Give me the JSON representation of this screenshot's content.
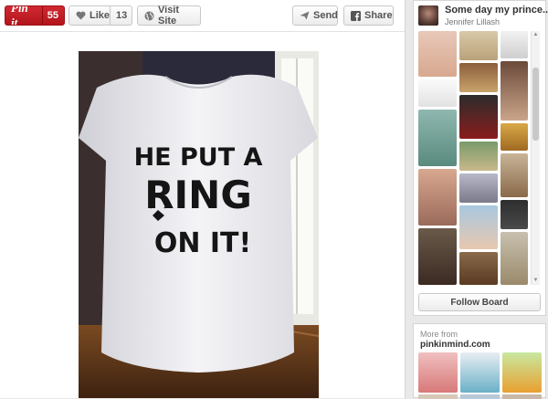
{
  "toolbar": {
    "pin_label": "Pin it",
    "pin_count": "55",
    "like_label": "Like",
    "like_count": "13",
    "visit_label": "Visit Site",
    "send_label": "Send",
    "share_label": "Share"
  },
  "photo": {
    "line1": "HE PUT A",
    "line2": "RING",
    "line3": "ON IT!"
  },
  "board": {
    "title": "Some day my prince...",
    "owner": "Jennifer Lillash",
    "follow_label": "Follow Board"
  },
  "more": {
    "label": "More from",
    "domain": "pinkinmind.com"
  },
  "colors": {
    "pin_red": "#c8232c",
    "toolbar_bg": "#ffffff",
    "page_bg": "#e9e9e9"
  }
}
